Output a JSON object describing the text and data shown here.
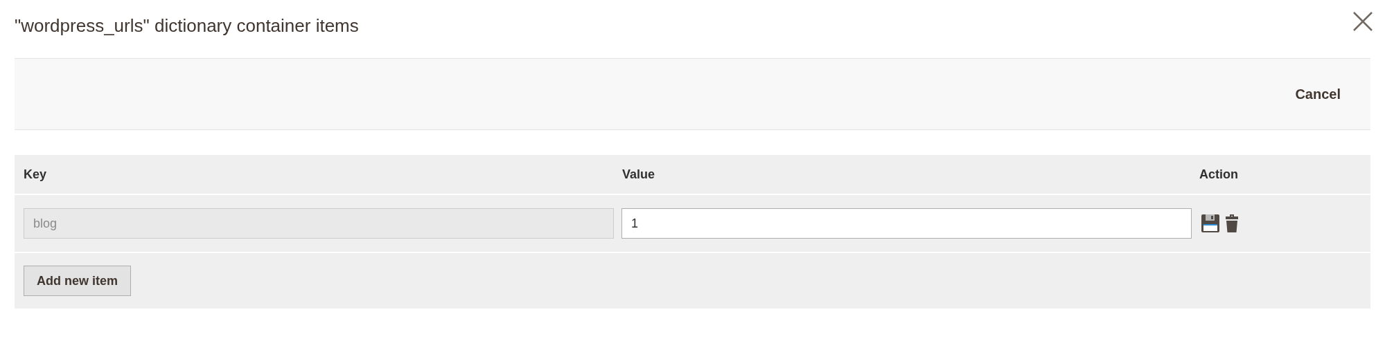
{
  "modal": {
    "title": "\"wordpress_urls\" dictionary container items"
  },
  "toolbar": {
    "buttons": [
      "Cancel"
    ]
  },
  "table": {
    "columns": [
      "Key",
      "Value",
      "Action"
    ],
    "rows": [
      {
        "key": {
          "value": "blog",
          "disabled": true
        },
        "value": {
          "value": "1",
          "disabled": false
        }
      }
    ],
    "add_button": "Add new item"
  }
}
